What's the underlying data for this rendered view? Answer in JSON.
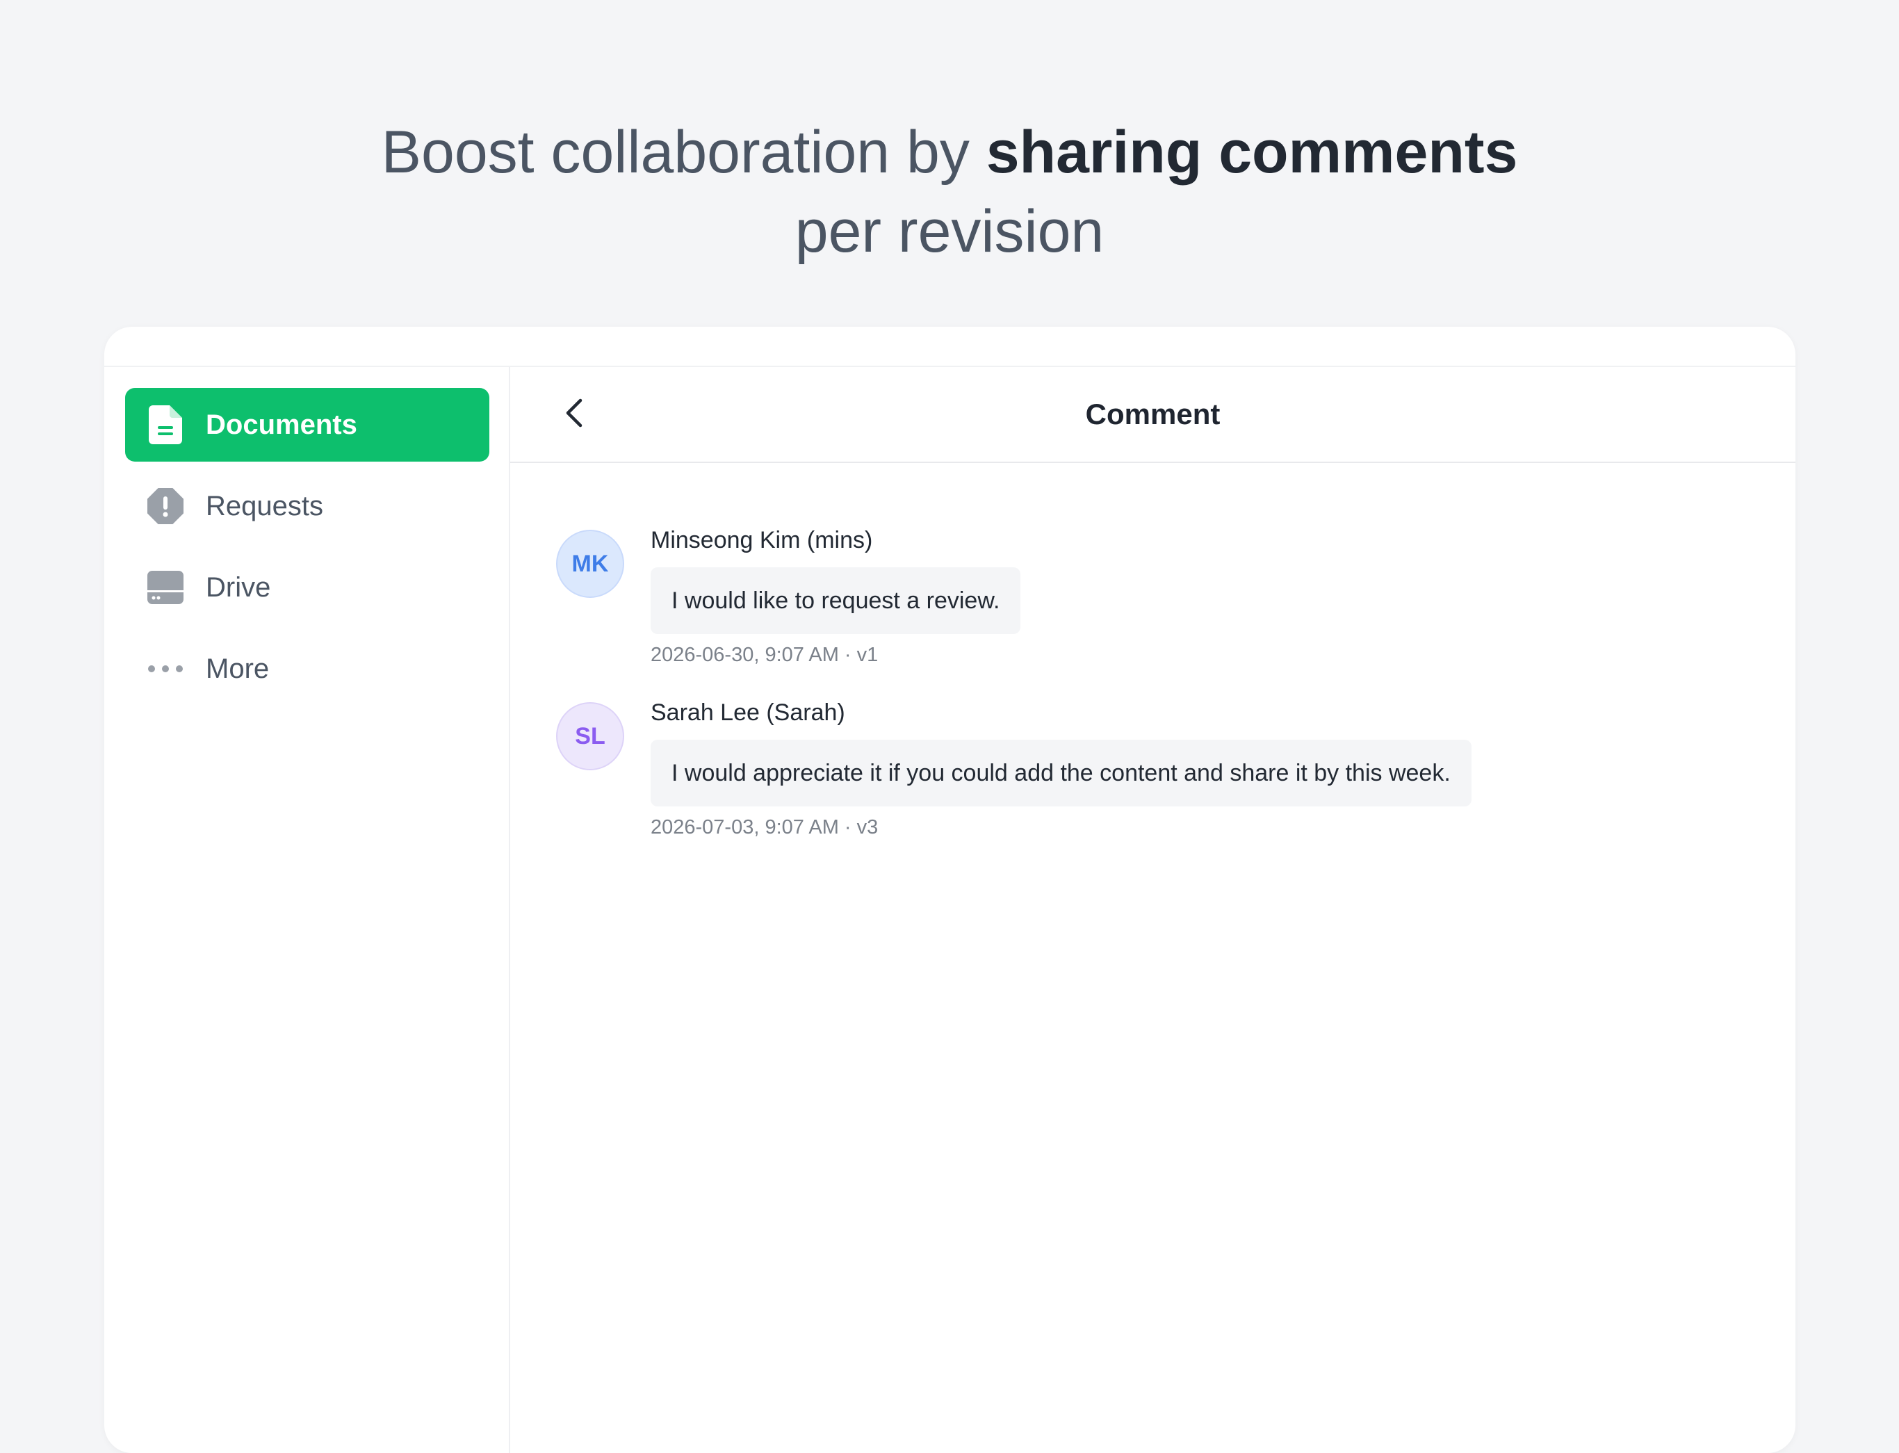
{
  "headline": {
    "part1": "Boost collaboration by ",
    "emphasis": "sharing comments",
    "line2": "per revision"
  },
  "sidebar": {
    "items": [
      {
        "label": "Documents",
        "icon": "document-icon",
        "active": true
      },
      {
        "label": "Requests",
        "icon": "alert-octagon-icon",
        "active": false
      },
      {
        "label": "Drive",
        "icon": "drive-icon",
        "active": false
      },
      {
        "label": "More",
        "icon": "more-dots-icon",
        "active": false
      }
    ]
  },
  "topbar": {
    "back_icon": "chevron-left-icon",
    "title": "Comment"
  },
  "comments": [
    {
      "initials": "MK",
      "author": "Minseong Kim (mins)",
      "text": "I would like to request a review.",
      "meta": "2026-06-30, 9:07 AM · v1",
      "avatar_bg": "#dbe8fd",
      "avatar_border": "#c9dafb",
      "avatar_fg": "#3f7de8"
    },
    {
      "initials": "SL",
      "author": "Sarah Lee (Sarah)",
      "text": "I would appreciate it if you could add the content and share it by this week.",
      "meta": "2026-07-03, 9:07 AM · v3",
      "avatar_bg": "#ede7fc",
      "avatar_border": "#ddd3f8",
      "avatar_fg": "#8b5cf0"
    }
  ],
  "colors": {
    "accent": "#0dbf6d",
    "background": "#f4f5f7",
    "icon_gray": "#9aa0a8"
  }
}
